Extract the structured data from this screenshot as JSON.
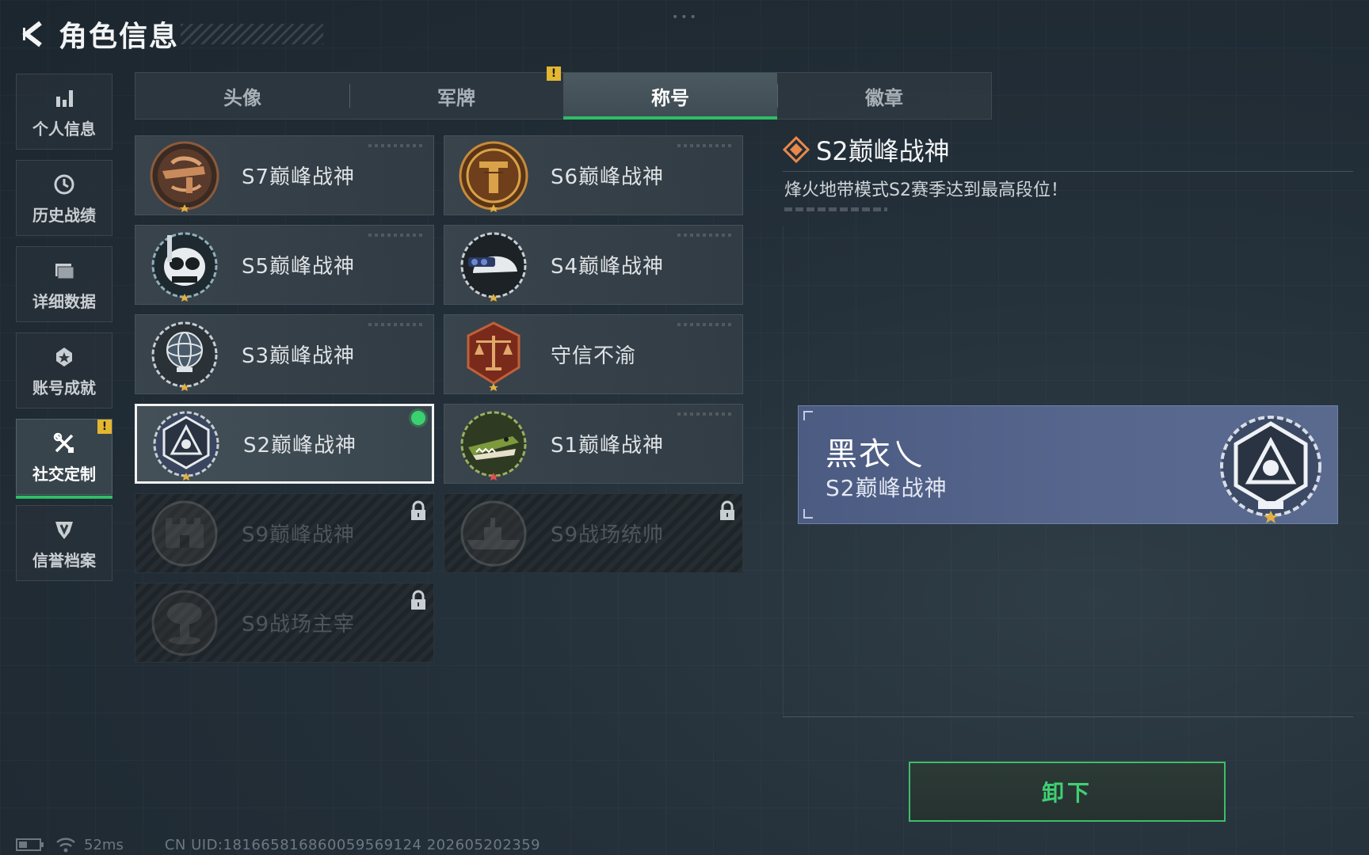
{
  "header": {
    "title": "角色信息"
  },
  "side_nav": [
    {
      "label": "个人信息",
      "icon": "bar-chart-icon",
      "active": false,
      "alert": false
    },
    {
      "label": "历史战绩",
      "icon": "clock-history-icon",
      "active": false,
      "alert": false
    },
    {
      "label": "详细数据",
      "icon": "folder-icon",
      "active": false,
      "alert": false
    },
    {
      "label": "账号成就",
      "icon": "achievement-icon",
      "active": false,
      "alert": false
    },
    {
      "label": "社交定制",
      "icon": "tools-icon",
      "active": true,
      "alert": true
    },
    {
      "label": "信誉档案",
      "icon": "shield-icon",
      "active": false,
      "alert": false
    }
  ],
  "alert_mark": "!",
  "tabs": [
    {
      "label": "头像",
      "active": false
    },
    {
      "label": "军牌",
      "active": false,
      "alert": true
    },
    {
      "label": "称号",
      "active": true
    },
    {
      "label": "徽章",
      "active": false
    }
  ],
  "titles": [
    {
      "label": "S7巅峰战神",
      "state": "normal",
      "badge": "s7-crossbow-badge-icon"
    },
    {
      "label": "S6巅峰战神",
      "state": "normal",
      "badge": "s6-emblem-badge-icon"
    },
    {
      "label": "S5巅峰战神",
      "state": "normal",
      "badge": "s5-diver-skull-badge-icon"
    },
    {
      "label": "S4巅峰战神",
      "state": "normal",
      "badge": "s4-helmet-badge-icon"
    },
    {
      "label": "S3巅峰战神",
      "state": "normal",
      "badge": "s3-globe-badge-icon"
    },
    {
      "label": "守信不渝",
      "state": "normal",
      "badge": "scales-badge-icon"
    },
    {
      "label": "S2巅峰战神",
      "state": "selected",
      "badge": "s2-hexagon-badge-icon"
    },
    {
      "label": "S1巅峰战神",
      "state": "normal",
      "badge": "s1-crocodile-badge-icon"
    },
    {
      "label": "S9巅峰战神",
      "state": "locked",
      "badge": "s9-fortress-badge-icon"
    },
    {
      "label": "S9战场统帅",
      "state": "locked",
      "badge": "s9-warship-badge-icon"
    },
    {
      "label": "S9战场主宰",
      "state": "locked",
      "badge": "s9-mushroom-cloud-badge-icon"
    }
  ],
  "detail": {
    "title": "S2巅峰战神",
    "description": "烽火地带模式S2赛季达到最高段位！"
  },
  "preview": {
    "player_name": "黑衣乀",
    "title": "S2巅峰战神"
  },
  "actions": {
    "unequip_label": "卸下"
  },
  "status": {
    "ping": "52ms",
    "uid_line": "CN UID:181665816860059569124 202605202359"
  },
  "colors": {
    "accent_green": "#2fbd66",
    "alert_yellow": "#e4b730",
    "preview_blue": "#4c5b82",
    "detail_icon_orange": "#e8894a"
  }
}
